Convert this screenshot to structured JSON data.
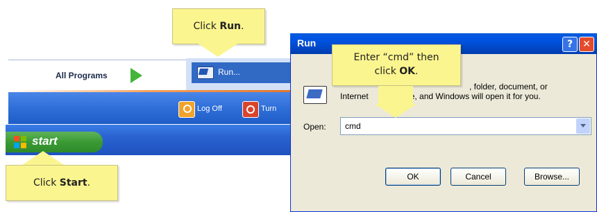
{
  "start_menu": {
    "all_programs": "All Programs",
    "run_item": "Run...",
    "log_off": "Log Off",
    "turn_off": "Turn",
    "start_button": "start"
  },
  "callouts": {
    "run_prefix": "Click ",
    "run_bold": "Run",
    "run_suffix": ".",
    "cmd_line1": "Enter “cmd” then",
    "cmd_line2_prefix": "click ",
    "cmd_line2_bold": "OK",
    "cmd_line2_suffix": ".",
    "start_prefix": "Click ",
    "start_bold": "Start",
    "start_suffix": "."
  },
  "run_dialog": {
    "title": "Run",
    "help_glyph": "?",
    "close_glyph": "✕",
    "description_line1": ", folder, document, or",
    "description_line2_a": "Internet",
    "description_line2_b": "e, and Windows will open it for you.",
    "open_label": "Open:",
    "open_value": "cmd",
    "ok": "OK",
    "cancel": "Cancel",
    "browse": "Browse..."
  },
  "colors": {
    "callout_yellow": "#fbf58f",
    "xp_blue": "#0054e3",
    "start_green": "#3a9a35",
    "selected_blue": "#316ac5"
  },
  "icons": [
    "play-icon",
    "run-icon",
    "logoff-key-icon",
    "power-icon",
    "windows-logo-icon",
    "help-icon",
    "close-icon",
    "dropdown-arrow-icon"
  ]
}
